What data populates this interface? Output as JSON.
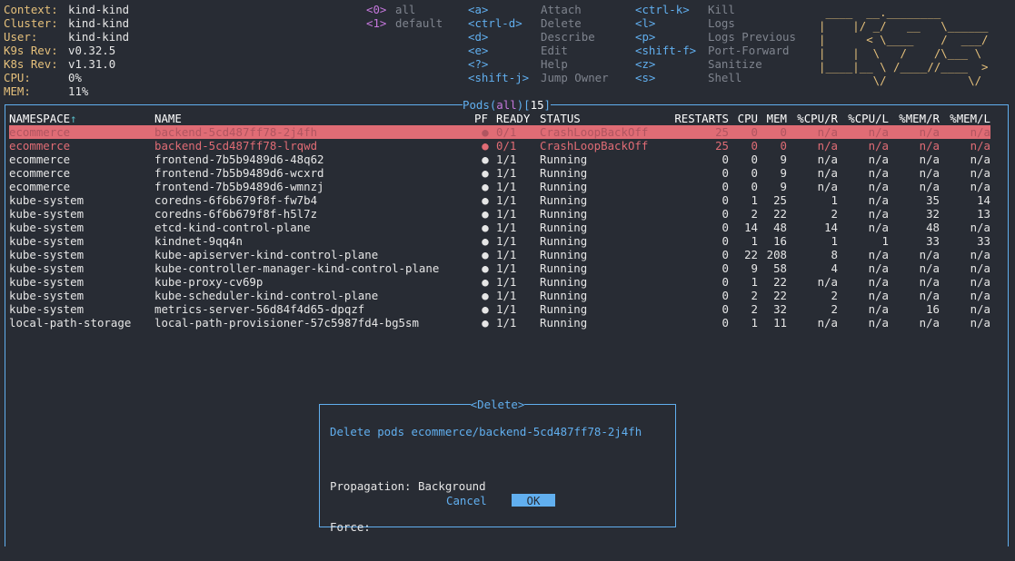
{
  "header": {
    "info": [
      {
        "label": "Context:",
        "value": "kind-kind"
      },
      {
        "label": "Cluster:",
        "value": "kind-kind"
      },
      {
        "label": "User:",
        "value": "kind-kind"
      },
      {
        "label": "K9s Rev:",
        "value": "v0.32.5"
      },
      {
        "label": "K8s Rev:",
        "value": "v1.31.0"
      },
      {
        "label": "CPU:",
        "value": "0%"
      },
      {
        "label": "MEM:",
        "value": "11%"
      }
    ],
    "namespaces": [
      {
        "key": "<0>",
        "label": "all"
      },
      {
        "key": "<1>",
        "label": "default"
      }
    ],
    "actions_col1": [
      {
        "key": "<a>",
        "label": "Attach"
      },
      {
        "key": "<ctrl-d>",
        "label": "Delete"
      },
      {
        "key": "<d>",
        "label": "Describe"
      },
      {
        "key": "<e>",
        "label": "Edit"
      },
      {
        "key": "<?>",
        "label": "Help"
      },
      {
        "key": "<shift-j>",
        "label": "Jump Owner"
      }
    ],
    "actions_col2": [
      {
        "key": "<ctrl-k>",
        "label": "Kill"
      },
      {
        "key": "<l>",
        "label": "Logs"
      },
      {
        "key": "<p>",
        "label": "Logs Previous"
      },
      {
        "key": "<shift-f>",
        "label": "Port-Forward"
      },
      {
        "key": "<z>",
        "label": "Sanitize"
      },
      {
        "key": "<s>",
        "label": "Shell"
      }
    ],
    "logo_lines": [
      " ____  __.________        ",
      "|    |/ _/   __   \\______ ",
      "|      < \\____    /  ___/ ",
      "|    |  \\   /    /\\___ \\  ",
      "|____|__ \\ /____//____  > ",
      "        \\/            \\/  "
    ]
  },
  "pods_view": {
    "title_resource": "Pods",
    "title_filter": "all",
    "title_count": "15",
    "columns": [
      "NAMESPACE↑",
      "NAME",
      "PF",
      "READY",
      "STATUS",
      "RESTARTS",
      "CPU",
      "MEM",
      "%CPU/R",
      "%CPU/L",
      "%MEM/R",
      "%MEM/L"
    ],
    "rows": [
      {
        "state": "sel",
        "cells": [
          "ecommerce",
          "backend-5cd487ff78-2j4fh",
          "●",
          "0/1",
          "CrashLoopBackOff",
          "25",
          "0",
          "0",
          "n/a",
          "n/a",
          "n/a",
          "n/a"
        ]
      },
      {
        "state": "err",
        "cells": [
          "ecommerce",
          "backend-5cd487ff78-lrqwd",
          "●",
          "0/1",
          "CrashLoopBackOff",
          "25",
          "0",
          "0",
          "n/a",
          "n/a",
          "n/a",
          "n/a"
        ]
      },
      {
        "state": "ok",
        "cells": [
          "ecommerce",
          "frontend-7b5b9489d6-48q62",
          "●",
          "1/1",
          "Running",
          "0",
          "0",
          "9",
          "n/a",
          "n/a",
          "n/a",
          "n/a"
        ]
      },
      {
        "state": "ok",
        "cells": [
          "ecommerce",
          "frontend-7b5b9489d6-wcxrd",
          "●",
          "1/1",
          "Running",
          "0",
          "0",
          "9",
          "n/a",
          "n/a",
          "n/a",
          "n/a"
        ]
      },
      {
        "state": "ok",
        "cells": [
          "ecommerce",
          "frontend-7b5b9489d6-wmnzj",
          "●",
          "1/1",
          "Running",
          "0",
          "0",
          "9",
          "n/a",
          "n/a",
          "n/a",
          "n/a"
        ]
      },
      {
        "state": "ok",
        "cells": [
          "kube-system",
          "coredns-6f6b679f8f-fw7b4",
          "●",
          "1/1",
          "Running",
          "0",
          "1",
          "25",
          "1",
          "n/a",
          "35",
          "14"
        ]
      },
      {
        "state": "ok",
        "cells": [
          "kube-system",
          "coredns-6f6b679f8f-h5l7z",
          "●",
          "1/1",
          "Running",
          "0",
          "2",
          "22",
          "2",
          "n/a",
          "32",
          "13"
        ]
      },
      {
        "state": "ok",
        "cells": [
          "kube-system",
          "etcd-kind-control-plane",
          "●",
          "1/1",
          "Running",
          "0",
          "14",
          "48",
          "14",
          "n/a",
          "48",
          "n/a"
        ]
      },
      {
        "state": "ok",
        "cells": [
          "kube-system",
          "kindnet-9qq4n",
          "●",
          "1/1",
          "Running",
          "0",
          "1",
          "16",
          "1",
          "1",
          "33",
          "33"
        ]
      },
      {
        "state": "ok",
        "cells": [
          "kube-system",
          "kube-apiserver-kind-control-plane",
          "●",
          "1/1",
          "Running",
          "0",
          "22",
          "208",
          "8",
          "n/a",
          "n/a",
          "n/a"
        ]
      },
      {
        "state": "ok",
        "cells": [
          "kube-system",
          "kube-controller-manager-kind-control-plane",
          "●",
          "1/1",
          "Running",
          "0",
          "9",
          "58",
          "4",
          "n/a",
          "n/a",
          "n/a"
        ]
      },
      {
        "state": "ok",
        "cells": [
          "kube-system",
          "kube-proxy-cv69p",
          "●",
          "1/1",
          "Running",
          "0",
          "1",
          "22",
          "n/a",
          "n/a",
          "n/a",
          "n/a"
        ]
      },
      {
        "state": "ok",
        "cells": [
          "kube-system",
          "kube-scheduler-kind-control-plane",
          "●",
          "1/1",
          "Running",
          "0",
          "2",
          "22",
          "2",
          "n/a",
          "n/a",
          "n/a"
        ]
      },
      {
        "state": "ok",
        "cells": [
          "kube-system",
          "metrics-server-56d84f4d65-dpqzf",
          "●",
          "1/1",
          "Running",
          "0",
          "2",
          "32",
          "2",
          "n/a",
          "16",
          "n/a"
        ]
      },
      {
        "state": "ok",
        "cells": [
          "local-path-storage",
          "local-path-provisioner-57c5987fd4-bg5sm",
          "●",
          "1/1",
          "Running",
          "0",
          "1",
          "11",
          "n/a",
          "n/a",
          "n/a",
          "n/a"
        ]
      }
    ]
  },
  "dialog": {
    "title": "<Delete>",
    "message": "Delete pods ecommerce/backend-5cd487ff78-2j4fh",
    "propagation_label": "Propagation:",
    "propagation_value": "Background",
    "force_label": "Force:",
    "cancel_label": "Cancel",
    "ok_label": "OK"
  }
}
